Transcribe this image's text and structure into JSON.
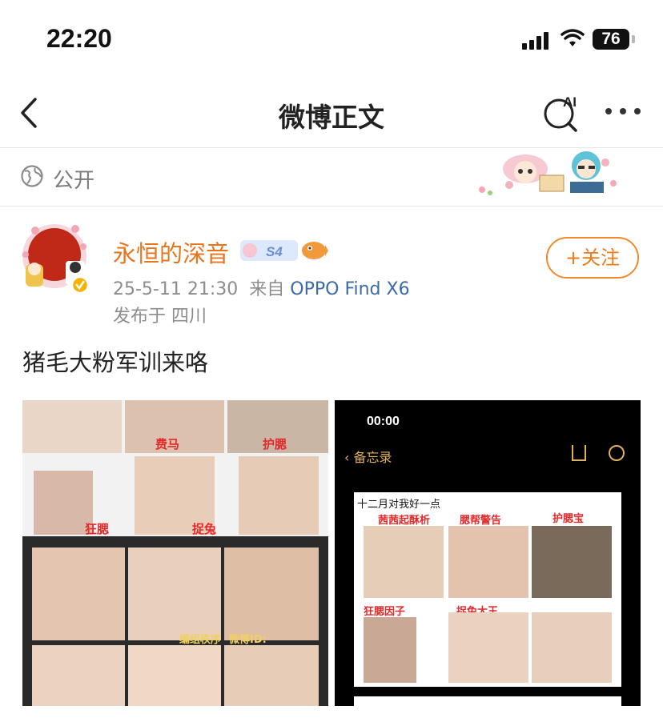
{
  "status_bar": {
    "time": "22:20",
    "battery": "76"
  },
  "nav": {
    "title": "微博正文",
    "ai_label": "AI"
  },
  "visibility": {
    "label": "公开"
  },
  "post": {
    "username": "永恒的深音",
    "badge_text": "S4",
    "date": "25-5-11 21:30",
    "source_prefix": "来自",
    "device": "OPPO Find X6",
    "location": "发布于 四川",
    "follow_label": "+关注",
    "text": "猪毛大粉军训来咯"
  },
  "image_left": {
    "captions": [
      "费马",
      "护腮",
      "狂腮",
      "捉兔",
      "编组秩序",
      "微博ID:"
    ]
  },
  "image_right": {
    "phone_time": "00:00",
    "back_label": "备忘录",
    "sheet_title": "十二月对我好一点",
    "captions": [
      "茜茜起酥析",
      "腮帮警告",
      "护腮宝",
      "狂腮因子",
      "捉兔大王"
    ]
  },
  "colors": {
    "accent": "#e8741b",
    "link": "#3d6aa8",
    "muted": "#8c8c8c"
  }
}
